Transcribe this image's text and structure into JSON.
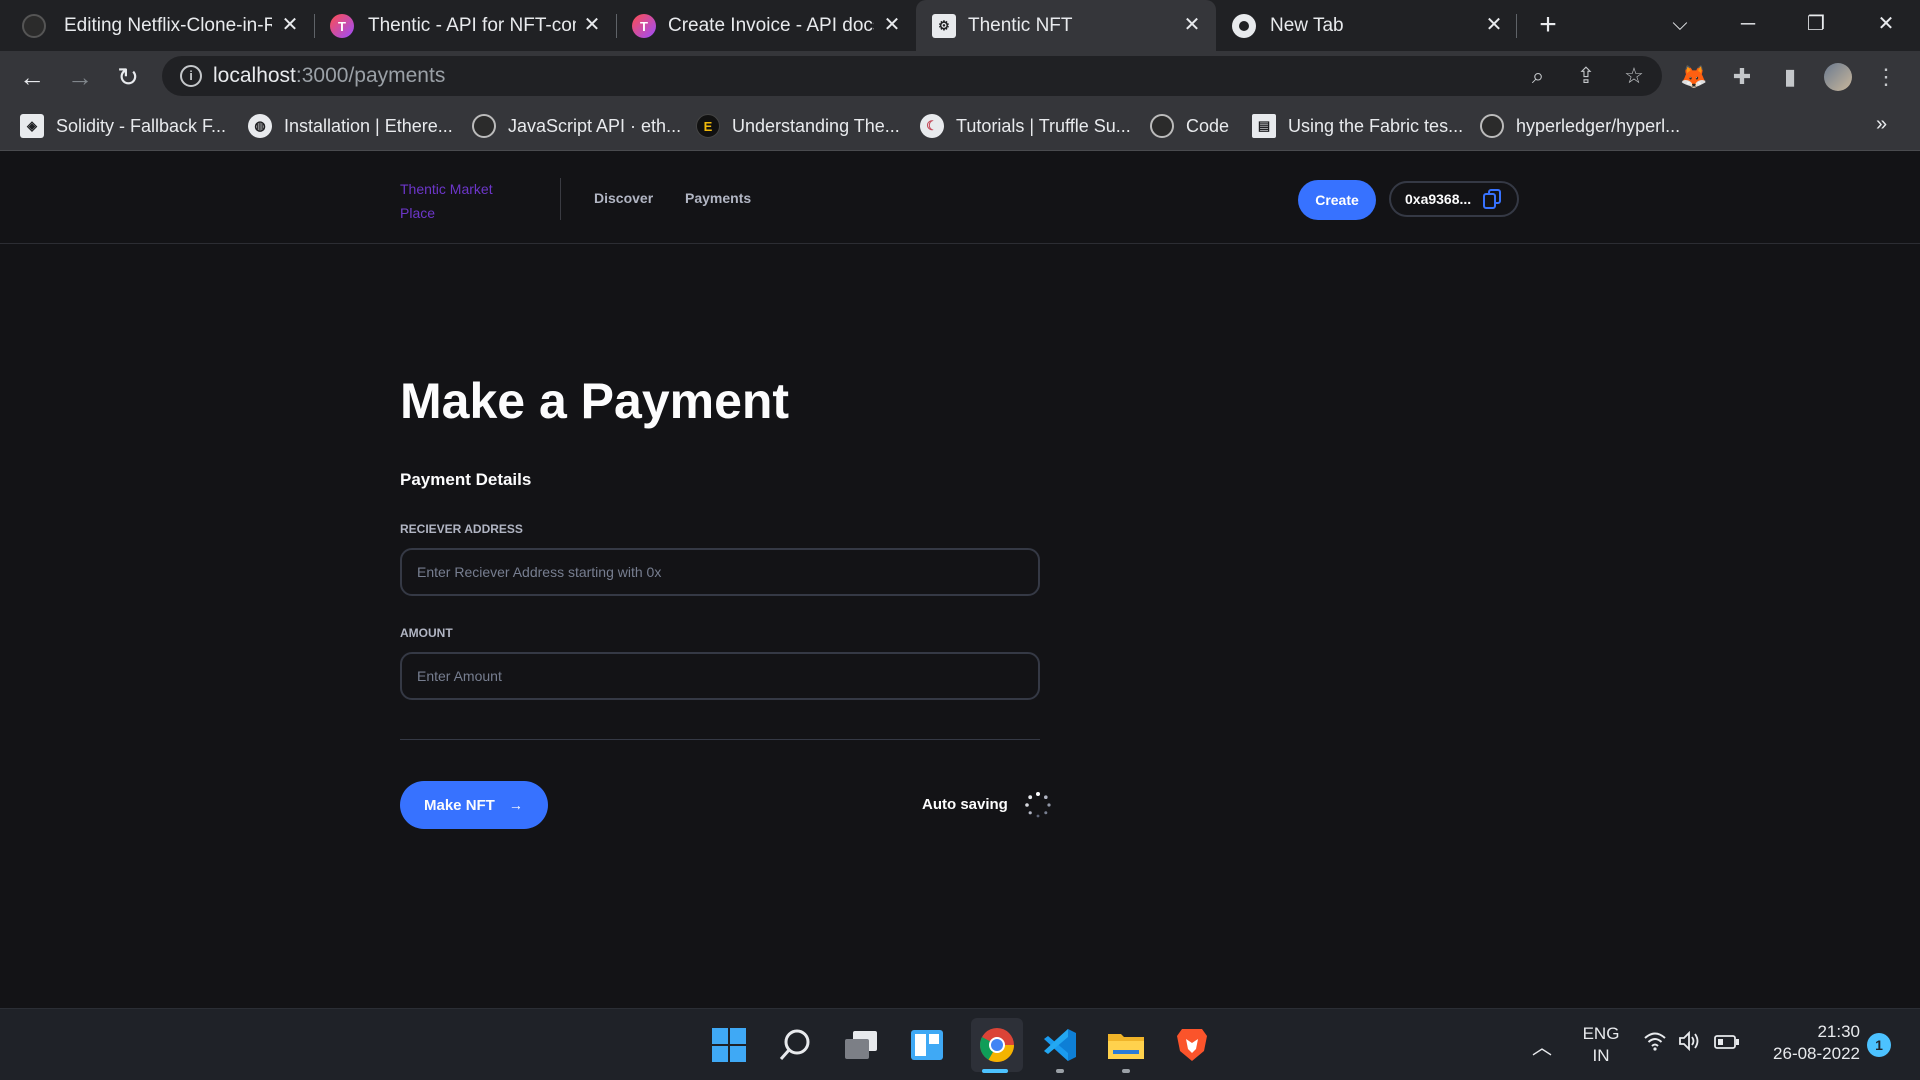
{
  "browser": {
    "tabs": [
      {
        "title": "Editing Netflix-Clone-in-React",
        "icon": "github-icon",
        "active": false
      },
      {
        "title": "Thentic - API for NFT-com",
        "icon": "thentic-icon",
        "active": false
      },
      {
        "title": "Create Invoice - API docs",
        "icon": "thentic-icon",
        "active": false
      },
      {
        "title": "Thentic NFT",
        "icon": "thentic-nft-icon",
        "active": true
      },
      {
        "title": "New Tab",
        "icon": "chrome-icon",
        "active": false
      }
    ],
    "address_host": "localhost",
    "address_path": ":3000/payments",
    "bookmarks": [
      {
        "label": "Solidity - Fallback F...",
        "icon": "solidity-icon"
      },
      {
        "label": "Installation | Ethere...",
        "icon": "globe-icon"
      },
      {
        "label": "JavaScript API · eth...",
        "icon": "github-icon"
      },
      {
        "label": "Understanding The...",
        "icon": "etherscan-icon"
      },
      {
        "label": "Tutorials | Truffle Su...",
        "icon": "truffle-icon"
      },
      {
        "label": "Code",
        "icon": "github-icon"
      },
      {
        "label": "Using the Fabric tes...",
        "icon": "document-icon"
      },
      {
        "label": "hyperledger/hyperl...",
        "icon": "github-icon"
      }
    ],
    "more_bookmarks": "»"
  },
  "site": {
    "logo_text": "Thentic Market Place",
    "nav": [
      {
        "label": "Discover"
      },
      {
        "label": "Payments"
      }
    ],
    "create_label": "Create",
    "wallet_address": "0xa9368..."
  },
  "form": {
    "title": "Make a Payment",
    "section_title": "Payment Details",
    "receiver_label": "RECIEVER ADDRESS",
    "receiver_placeholder": "Enter Reciever Address starting with 0x",
    "amount_label": "AMOUNT",
    "amount_placeholder": "Enter Amount",
    "submit_label": "Make NFT",
    "submit_arrow": "→",
    "autosave_label": "Auto saving"
  },
  "taskbar": {
    "apps": [
      "windows-start-icon",
      "search-icon",
      "task-view-icon",
      "widgets-icon",
      "chrome-icon",
      "vscode-icon",
      "file-explorer-icon",
      "brave-icon"
    ],
    "language_line1": "ENG",
    "language_line2": "IN",
    "time": "21:30",
    "date": "26-08-2022",
    "notification_count": "1"
  },
  "colors": {
    "accent": "#3772ff",
    "logo": "#6c36c9",
    "page_bg": "#131316"
  }
}
